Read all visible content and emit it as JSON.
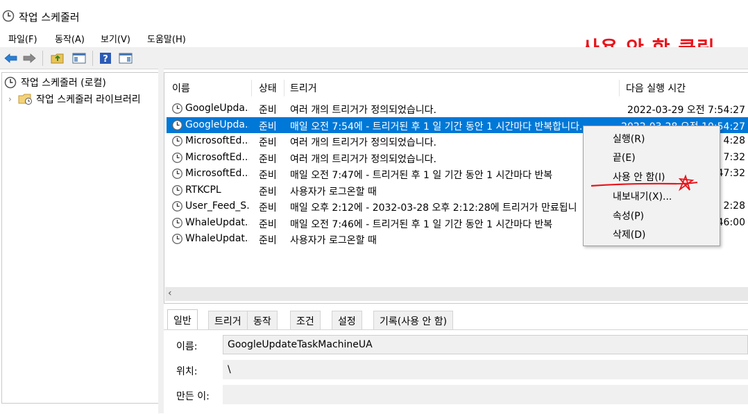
{
  "window": {
    "title": "작업 스케줄러"
  },
  "menu": [
    "파일(F)",
    "동작(A)",
    "보기(V)",
    "도움말(H)"
  ],
  "annotation": "사용 안 함 클릭",
  "toolbar": {
    "icons": [
      "back-arrow-icon",
      "forward-arrow-icon",
      "folder-up-icon",
      "show-hide-console-tree-icon",
      "help-icon",
      "show-hide-action-pane-icon"
    ]
  },
  "tree": {
    "root": "작업 스케줄러 (로컬)",
    "child": "작업 스케줄러 라이브러리"
  },
  "table": {
    "columns": [
      "이름",
      "상태",
      "트리거",
      "다음 실행 시간"
    ],
    "rows": [
      {
        "name": "GoogleUpda...",
        "status": "준비",
        "trigger": "여러 개의 트리거가 정의되었습니다.",
        "next": "2022-03-29 오전 7:54:27"
      },
      {
        "name": "GoogleUpda...",
        "status": "준비",
        "trigger": "매일 오전 7:54에 - 트리거된 후 1 일 기간 동안 1 시간마다 반복합니다.",
        "next": "2022-03-28 오전 10:54:27"
      },
      {
        "name": "MicrosoftEd...",
        "status": "준비",
        "trigger": "여러 개의 트리거가 정의되었습니다.",
        "next": "4:28"
      },
      {
        "name": "MicrosoftEd...",
        "status": "준비",
        "trigger": "여러 개의 트리거가 정의되었습니다.",
        "next": "7:32"
      },
      {
        "name": "MicrosoftEd...",
        "status": "준비",
        "trigger": "매일 오전 7:47에 - 트리거된 후 1 일 기간 동안 1 시간마다 반복",
        "next": "47:32"
      },
      {
        "name": "RTKCPL",
        "status": "준비",
        "trigger": "사용자가 로그온할 때",
        "next": ""
      },
      {
        "name": "User_Feed_S...",
        "status": "준비",
        "trigger": "매일 오후 2:12에 - 2032-03-28 오후 2:12:28에 트리거가 만료됩니",
        "next": "2:28"
      },
      {
        "name": "WhaleUpdat...",
        "status": "준비",
        "trigger": "매일 오전 7:46에 - 트리거된 후 1 일 기간 동안 1 시간마다 반복",
        "next": "46:00"
      },
      {
        "name": "WhaleUpdat...",
        "status": "준비",
        "trigger": "사용자가 로그온할 때",
        "next": ""
      }
    ],
    "selected_index": 1
  },
  "context_menu": [
    "실행(R)",
    "끝(E)",
    "사용 안 함(I)",
    "내보내기(X)...",
    "속성(P)",
    "삭제(D)"
  ],
  "detail": {
    "tabs": [
      "일반",
      "트리거",
      "동작",
      "조건",
      "설정",
      "기록(사용 안 함)"
    ],
    "active_tab": 0,
    "fields": {
      "name_label": "이름:",
      "name_value": "GoogleUpdateTaskMachineUA",
      "location_label": "위치:",
      "location_value": "\\",
      "author_label": "만든 이:"
    }
  },
  "colors": {
    "selection": "#0078d7",
    "annotation": "#e8141b"
  }
}
